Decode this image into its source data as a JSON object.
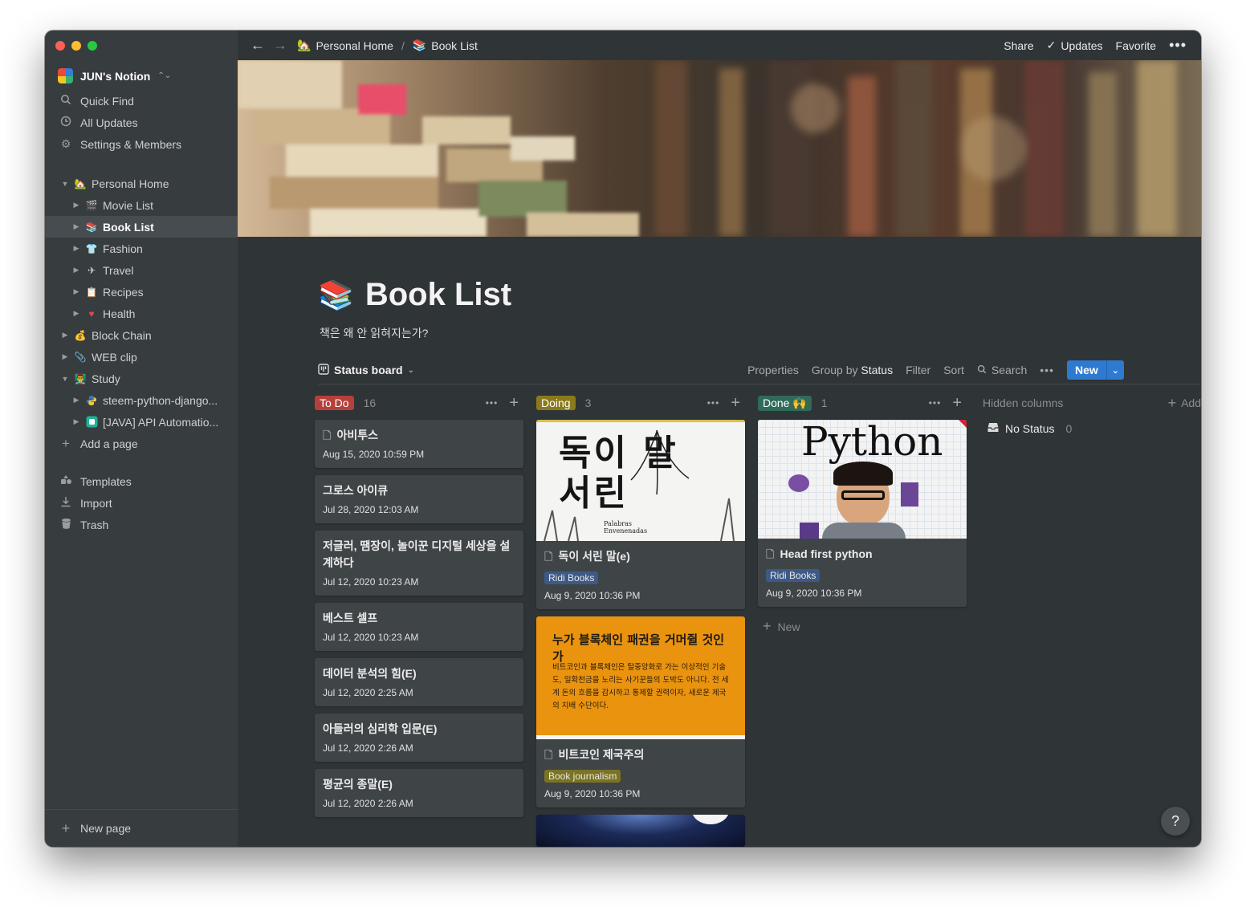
{
  "sidebar": {
    "workspace_name": "JUN's Notion",
    "top_items": [
      {
        "label": "Quick Find",
        "icon": "search-icon"
      },
      {
        "label": "All Updates",
        "icon": "clock-icon"
      },
      {
        "label": "Settings & Members",
        "icon": "gear-icon"
      }
    ],
    "pages": [
      {
        "label": "Personal Home",
        "icon": "house-icon",
        "level": 0,
        "expanded": true
      },
      {
        "label": "Movie List",
        "icon": "clapper-icon",
        "level": 1
      },
      {
        "label": "Book List",
        "icon": "books-icon",
        "level": 1,
        "selected": true
      },
      {
        "label": "Fashion",
        "icon": "shirt-icon",
        "level": 1
      },
      {
        "label": "Travel",
        "icon": "airplane-icon",
        "level": 1
      },
      {
        "label": "Recipes",
        "icon": "recipe-icon",
        "level": 1
      },
      {
        "label": "Health",
        "icon": "heartbeat-icon",
        "level": 1
      },
      {
        "label": "Block Chain",
        "icon": "money-bag-icon",
        "level": 0
      },
      {
        "label": "WEB clip",
        "icon": "paperclip-icon",
        "level": 0
      },
      {
        "label": "Study",
        "icon": "teacher-icon",
        "level": 0,
        "expanded": true
      },
      {
        "label": "steem-python-django...",
        "icon": "python-icon",
        "level": 1
      },
      {
        "label": "[JAVA] API Automatio...",
        "icon": "app-icon",
        "level": 1
      }
    ],
    "add_page": "Add a page",
    "bottom_items": [
      {
        "label": "Templates",
        "icon": "templates-icon"
      },
      {
        "label": "Import",
        "icon": "import-icon"
      },
      {
        "label": "Trash",
        "icon": "trash-icon"
      }
    ],
    "new_page": "New page"
  },
  "topbar": {
    "breadcrumb": [
      "Personal Home",
      "Book List"
    ],
    "separator": "/",
    "share": "Share",
    "updates": "Updates",
    "favorite": "Favorite"
  },
  "page": {
    "title": "Book List",
    "subtitle": "책은 왜 안 읽혀지는가?"
  },
  "view": {
    "name": "Status board",
    "properties": "Properties",
    "group_prefix": "Group by",
    "group_value": "Status",
    "filter": "Filter",
    "sort": "Sort",
    "search": "Search",
    "new": "New"
  },
  "board": {
    "columns": [
      {
        "name": "To Do",
        "count": "16",
        "color": "#b5403b",
        "cards": [
          {
            "title": "아비투스",
            "date": "Aug 15, 2020 10:59 PM",
            "doc_icon": true
          },
          {
            "title": "그로스 아이큐",
            "date": "Jul 28, 2020 12:03 AM"
          },
          {
            "title": "저글러, 땜장이, 놀이꾼 디지털 세상을 설계하다",
            "date": "Jul 12, 2020 10:23 AM"
          },
          {
            "title": "베스트 셀프",
            "date": "Jul 12, 2020 10:23 AM"
          },
          {
            "title": "데이터 분석의 힘(E)",
            "date": "Jul 12, 2020 2:25 AM"
          },
          {
            "title": "아들러의 심리학 입문(E)",
            "date": "Jul 12, 2020 2:26 AM"
          },
          {
            "title": "평균의 종말(E)",
            "date": "Jul 12, 2020 2:26 AM"
          }
        ]
      },
      {
        "name": "Doing",
        "count": "3",
        "color": "#8a7a1b",
        "cards": [
          {
            "title": "독이 서린 말(e)",
            "tag": "Ridi Books",
            "tag_color": "#3d5a87",
            "date": "Aug 9, 2020 10:36 PM",
            "cover_title": "독이 말 서린",
            "cover_subtitle": "Palabras Envenenadas"
          },
          {
            "title": "비트코인 제국주의",
            "tag": "Book journalism",
            "tag_color": "#7a7323",
            "date": "Aug 9, 2020 10:36 PM",
            "cover_title": "누가 블록체인 패권을 거머쥘 것인가",
            "cover_text": "비트코인과 블록체인은 탈중앙화로 가는 이상적인 기술도, 일확천금을 노리는 사기꾼들의 도박도 아니다. 전 세계 돈의 흐름을 감시하고 통제할 권력이자, 새로운 제국의 지배 수단이다."
          }
        ]
      },
      {
        "name": "Done 🙌",
        "count": "1",
        "color": "#2f6a5a",
        "cards": [
          {
            "title": "Head first python",
            "tag": "Ridi Books",
            "tag_color": "#3d5a87",
            "date": "Aug 9, 2020 10:36 PM",
            "cover_title": "Python"
          }
        ],
        "new_label": "New"
      }
    ],
    "hidden_columns": "Hidden columns",
    "add": "Add",
    "no_status": "No Status",
    "no_status_count": "0"
  },
  "help": "?"
}
